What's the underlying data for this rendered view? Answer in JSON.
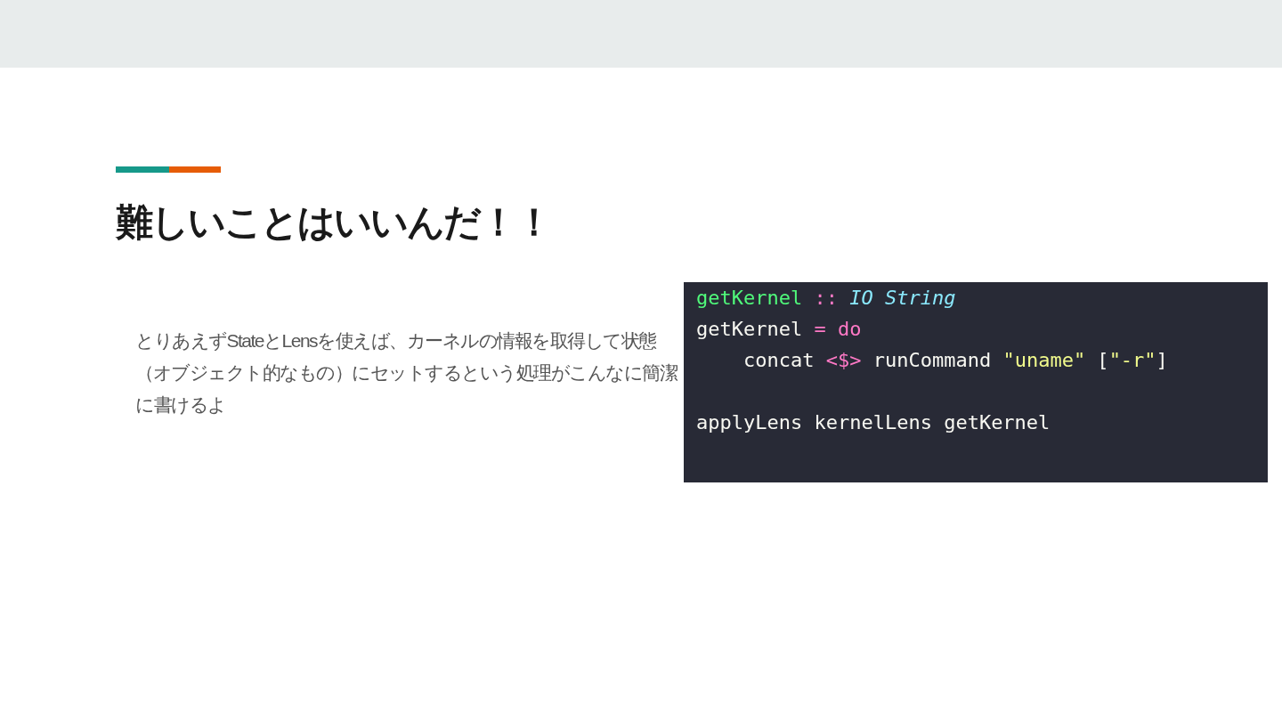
{
  "slide": {
    "title": "難しいことはいいんだ！！",
    "body": "とりあえずStateとLensを使えば、カーネルの情報を取得して状態（オブジェクト的なもの）にセットするという処理がこんなに簡潔に書けるよ",
    "code_blocks": [
      [
        [
          {
            "kind": "function",
            "text": "getKernel"
          },
          {
            "kind": "operator",
            "text": " ::"
          },
          {
            "kind": "type",
            "text": " IO String"
          }
        ],
        [
          {
            "kind": "plain",
            "text": "getKernel "
          },
          {
            "kind": "operator",
            "text": "="
          },
          {
            "kind": "keyword",
            "text": " do"
          }
        ],
        [
          {
            "kind": "plain",
            "text": "    concat "
          },
          {
            "kind": "operator",
            "text": "<$>"
          },
          {
            "kind": "plain",
            "text": " runCommand "
          },
          {
            "kind": "string",
            "text": "\"uname\""
          },
          {
            "kind": "plain",
            "text": " ["
          },
          {
            "kind": "string",
            "text": "\"-r\""
          },
          {
            "kind": "plain",
            "text": "]"
          }
        ]
      ],
      [
        [
          {
            "kind": "plain",
            "text": "applyLens kernelLens getKernel"
          }
        ]
      ]
    ]
  }
}
